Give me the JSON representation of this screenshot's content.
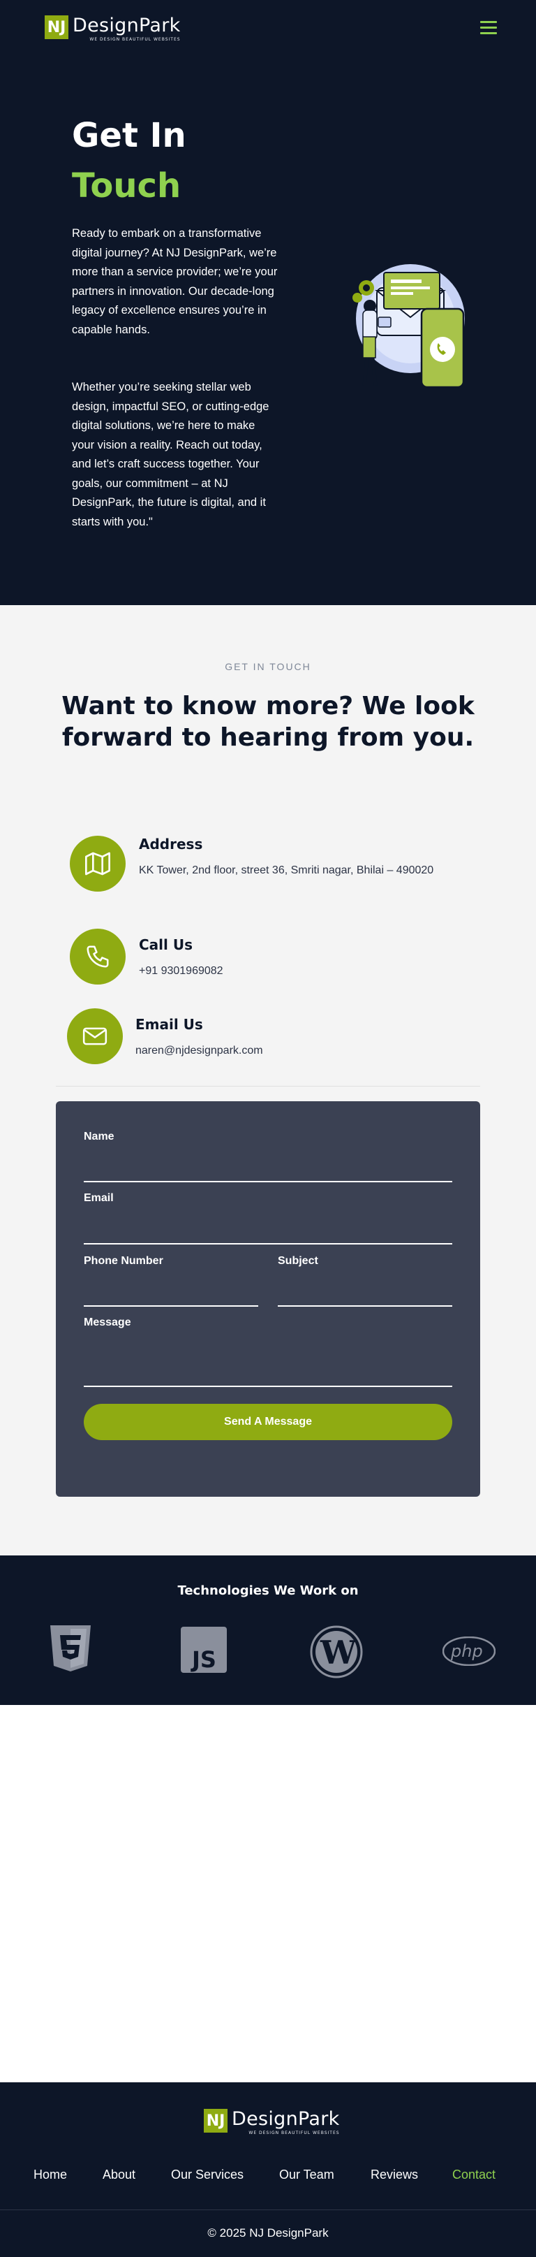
{
  "brand": {
    "initials": "NJ",
    "name": "DesignPark",
    "tagline": "WE DESIGN BEAUTIFUL WEBSITES"
  },
  "hero": {
    "title_line1": "Get In",
    "title_line2": "Touch",
    "paragraph1": "Ready to embark on a transformative digital journey? At NJ DesignPark, we’re more than a service provider; we’re your partners in innovation. Our decade-long legacy of excellence ensures you’re in capable hands.",
    "paragraph2": "Whether you’re seeking stellar web design, impactful SEO, or cutting-edge digital solutions, we’re here to make your vision a reality. Reach out today, and let’s craft success together. Your goals, our commitment – at NJ DesignPark, the future is digital, and it starts with you.\""
  },
  "contact": {
    "eyebrow": "GET IN TOUCH",
    "heading": "Want to know more? We look forward to hearing from you.",
    "address": {
      "title": "Address",
      "text": "KK Tower, 2nd floor, street 36, Smriti nagar, Bhilai – 490020"
    },
    "call": {
      "title": "Call Us",
      "text": "+91 9301969082"
    },
    "email": {
      "title": "Email Us",
      "text": "naren@njdesignpark.com"
    }
  },
  "form": {
    "name_label": "Name",
    "email_label": "Email",
    "phone_label": "Phone Number",
    "subject_label": "Subject",
    "message_label": "Message",
    "submit_label": "Send A Message"
  },
  "technologies": {
    "title": "Technologies We Work on",
    "icons": [
      "css3-icon",
      "javascript-icon",
      "wordpress-icon",
      "php-icon"
    ]
  },
  "footer": {
    "nav": [
      "Home",
      "About",
      "Our Services",
      "Our Team",
      "Reviews",
      "Contact"
    ],
    "active": "Contact",
    "copyright": "© 2025 NJ DesignPark"
  },
  "colors": {
    "navy": "#0d1628",
    "accent_green": "#8fab12",
    "light_green": "#8fd14f",
    "card": "#3b4153"
  }
}
